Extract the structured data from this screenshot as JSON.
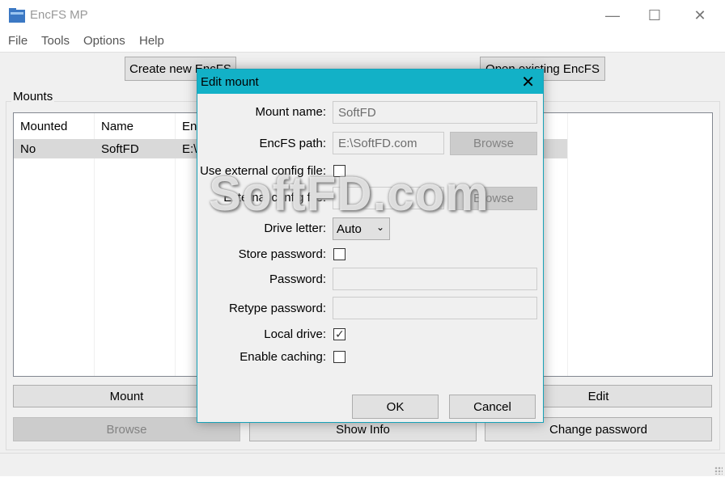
{
  "window": {
    "title": "EncFS MP",
    "minimize": "—",
    "maximize": "☐",
    "close": "✕"
  },
  "menu": [
    "File",
    "Tools",
    "Options",
    "Help"
  ],
  "toolbar": {
    "create": "Create new EncFS",
    "open": "Open existing EncFS"
  },
  "mounts": {
    "group_label": "Mounts",
    "columns": [
      "Mounted",
      "Name",
      "En"
    ],
    "rows": [
      {
        "mounted": "No",
        "name": "SoftFD",
        "path": "E:\\"
      }
    ]
  },
  "bottom_buttons": {
    "mount": "Mount",
    "edit": "Edit",
    "browse": "Browse",
    "show_info": "Show Info",
    "change_password": "Change password"
  },
  "dialog": {
    "title": "Edit mount",
    "close": "✕",
    "mount_name_label": "Mount name:",
    "mount_name_value": "SoftFD",
    "encfs_path_label": "EncFS path:",
    "encfs_path_value": "E:\\SoftFD.com",
    "browse1": "Browse",
    "use_external_label": "Use external config file:",
    "external_config_label": "External config file:",
    "browse2": "Browse",
    "drive_letter_label": "Drive letter:",
    "drive_letter_value": "Auto",
    "store_password_label": "Store password:",
    "password_label": "Password:",
    "retype_password_label": "Retype password:",
    "local_drive_label": "Local drive:",
    "enable_caching_label": "Enable caching:",
    "ok": "OK",
    "cancel": "Cancel"
  },
  "watermark": "SoftFD.com"
}
